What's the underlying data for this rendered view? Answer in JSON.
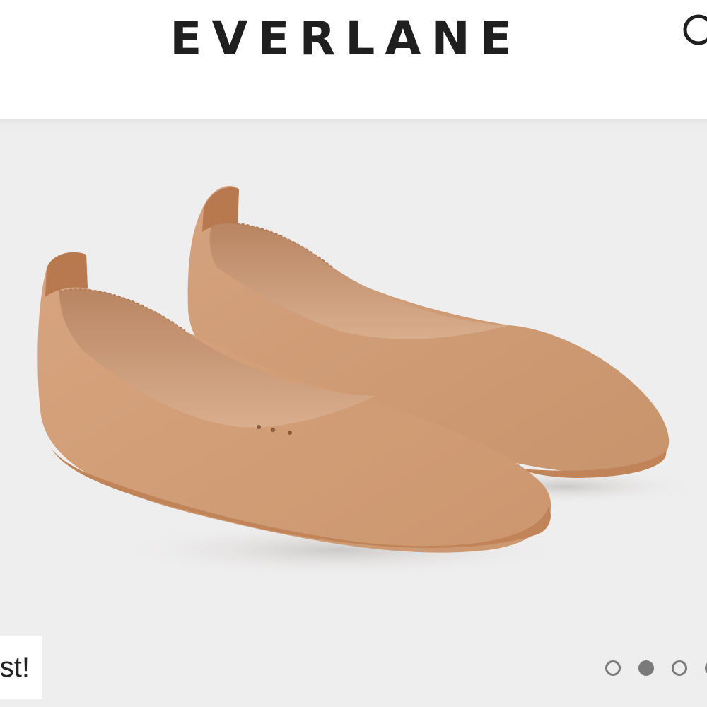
{
  "header": {
    "logo_text": "EVERLANE",
    "search_icon": "search-icon"
  },
  "hero": {
    "image_icon": "product-photo-flats",
    "badge_text": "st!",
    "carousel": {
      "total_visible": 4,
      "active_index": 1
    }
  },
  "colors": {
    "logo": "#1f1f1f",
    "hero_bg": "#efeeee",
    "leather": "#cf9d77",
    "dot": "#7a7a7a"
  }
}
